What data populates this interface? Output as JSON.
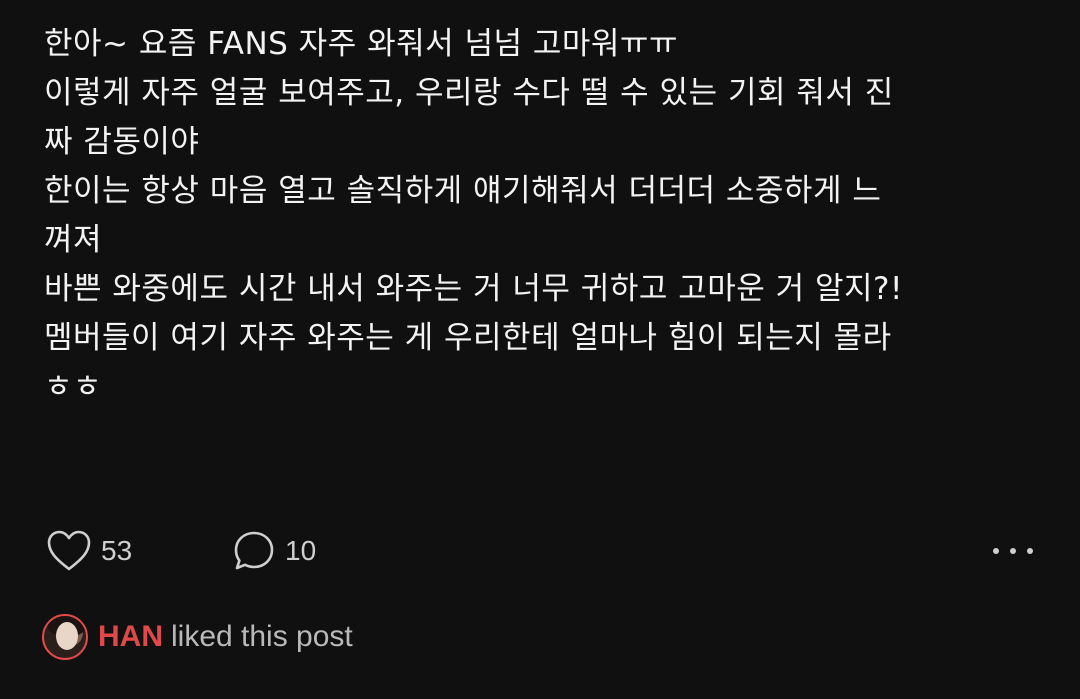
{
  "post": {
    "lines": [
      "한아~ 요즘 FANS 자주 와줘서 넘넘 고마워ㅠㅠ",
      "이렇게 자주 얼굴 보여주고, 우리랑 수다 떨 수 있는 기회 줘서 진",
      "짜 감동이야",
      "한이는 항상 마음 열고 솔직하게 얘기해줘서 더더더 소중하게 느",
      "껴져",
      "바쁜 와중에도 시간 내서 와주는 거 너무 귀하고 고마운 거 알지?!",
      "멤버들이 여기 자주 와주는 게 우리한테 얼마나 힘이 되는지 몰라",
      "ㅎㅎ"
    ]
  },
  "actions": {
    "like_icon": "heart-icon",
    "like_count": "53",
    "reply_icon": "speech-bubble-icon",
    "reply_count": "10",
    "more_icon": "more-dots-icon"
  },
  "liked_by": {
    "name": "HAN",
    "suffix": "liked this post",
    "accent_color": "#e0484a"
  },
  "colors": {
    "background": "#101010",
    "text": "#f3f3f3",
    "muted": "#cfcfcf"
  }
}
